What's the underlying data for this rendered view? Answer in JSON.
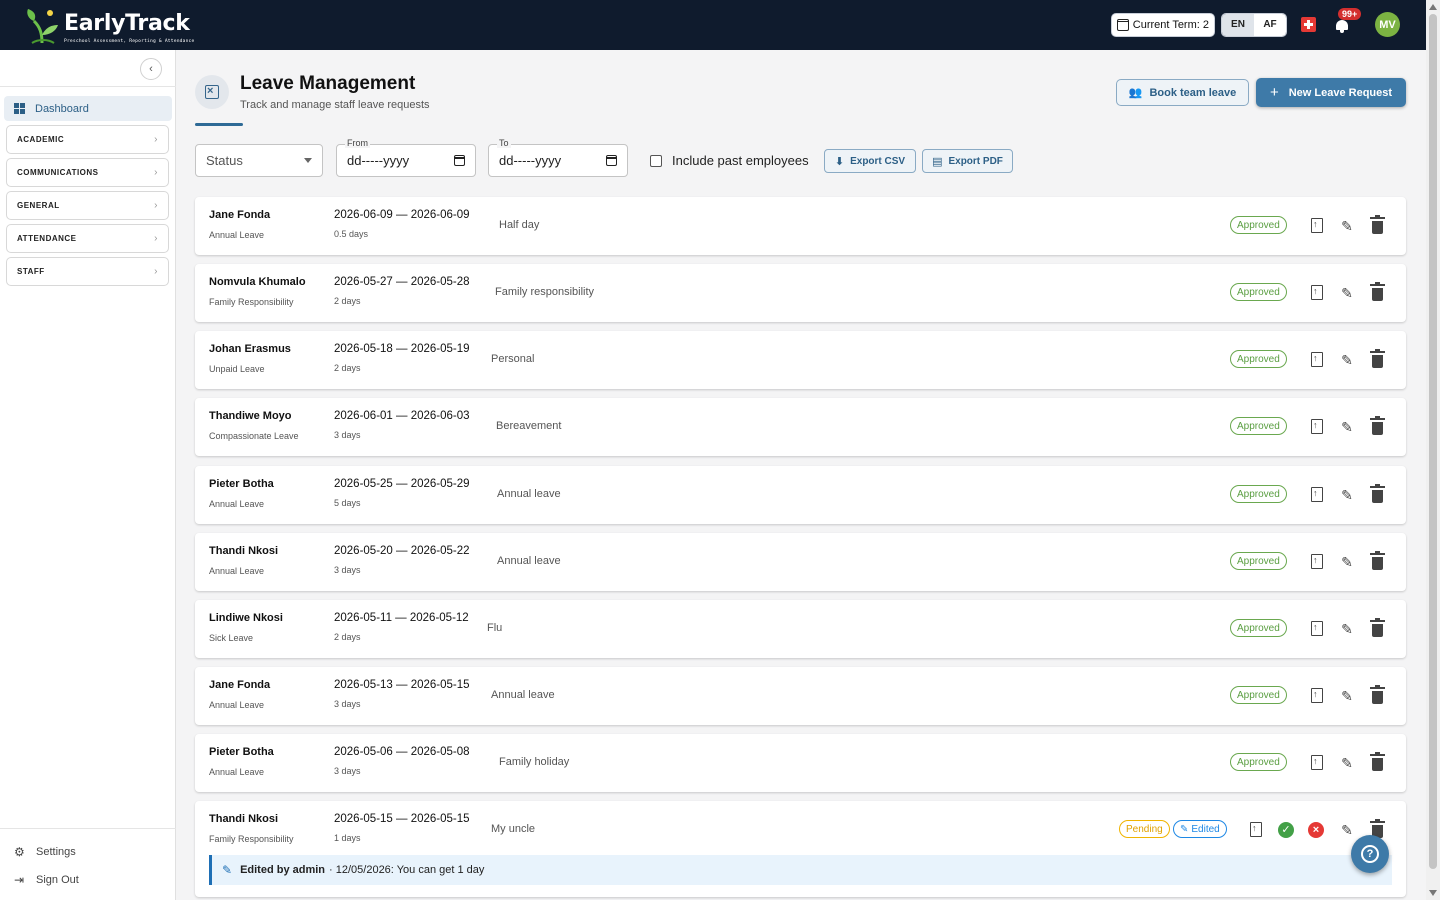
{
  "brand": {
    "name": "EarlyTrack",
    "tagline": "Preschool Assessment, Reporting & Attendance"
  },
  "topbar": {
    "term_label": "Current Term: 2",
    "languages": [
      "EN",
      "AF"
    ],
    "notifications_badge": "99+",
    "avatar_initials": "MV"
  },
  "sidebar": {
    "dashboard": "Dashboard",
    "sections": [
      "ACADEMIC",
      "COMMUNICATIONS",
      "GENERAL",
      "ATTENDANCE",
      "STAFF"
    ],
    "settings": "Settings",
    "sign_out": "Sign Out"
  },
  "page": {
    "title": "Leave Management",
    "subtitle": "Track and manage staff leave requests",
    "book_team_leave": "Book team leave",
    "new_leave_request": "New Leave Request"
  },
  "filters": {
    "status_placeholder": "Status",
    "from_label": "From",
    "to_label": "To",
    "date_placeholder": "dd-----yyyy",
    "include_past": "Include past employees",
    "export_csv": "Export CSV",
    "export_pdf": "Export PDF"
  },
  "requests": [
    {
      "name": "Jane Fonda",
      "type": "Annual Leave",
      "dates": "2026-06-09 — 2026-06-09",
      "days": "0.5 days",
      "reason": "Half day",
      "status": "Approved"
    },
    {
      "name": "Nomvula Khumalo",
      "type": "Family Responsibility",
      "dates": "2026-05-27 — 2026-05-28",
      "days": "2 days",
      "reason": "Family responsibility",
      "status": "Approved"
    },
    {
      "name": "Johan Erasmus",
      "type": "Unpaid Leave",
      "dates": "2026-05-18 — 2026-05-19",
      "days": "2 days",
      "reason": "Personal",
      "status": "Approved"
    },
    {
      "name": "Thandiwe Moyo",
      "type": "Compassionate Leave",
      "dates": "2026-06-01 — 2026-06-03",
      "days": "3 days",
      "reason": "Bereavement",
      "status": "Approved"
    },
    {
      "name": "Pieter Botha",
      "type": "Annual Leave",
      "dates": "2026-05-25 — 2026-05-29",
      "days": "5 days",
      "reason": "Annual leave",
      "status": "Approved"
    },
    {
      "name": "Thandi Nkosi",
      "type": "Annual Leave",
      "dates": "2026-05-20 — 2026-05-22",
      "days": "3 days",
      "reason": "Annual leave",
      "status": "Approved"
    },
    {
      "name": "Lindiwe Nkosi",
      "type": "Sick Leave",
      "dates": "2026-05-11 — 2026-05-12",
      "days": "2 days",
      "reason": "Flu",
      "status": "Approved"
    },
    {
      "name": "Jane Fonda",
      "type": "Annual Leave",
      "dates": "2026-05-13 — 2026-05-15",
      "days": "3 days",
      "reason": "Annual leave",
      "status": "Approved"
    },
    {
      "name": "Pieter Botha",
      "type": "Annual Leave",
      "dates": "2026-05-06 — 2026-05-08",
      "days": "3 days",
      "reason": "Family holiday",
      "status": "Approved"
    },
    {
      "name": "Thandi Nkosi",
      "type": "Family Responsibility",
      "dates": "2026-05-15 — 2026-05-15",
      "days": "1 days",
      "reason": "My uncle",
      "status": "Pending",
      "edited": "Edited",
      "note_author": "Edited by admin",
      "note_text": "· 12/05/2026: You can get 1 day"
    }
  ],
  "colors": {
    "topbar": "#0f1b2d",
    "accent": "#3e7aa8",
    "approved": "#5a9e41",
    "pending": "#e0a200",
    "edited": "#1e88e5"
  }
}
